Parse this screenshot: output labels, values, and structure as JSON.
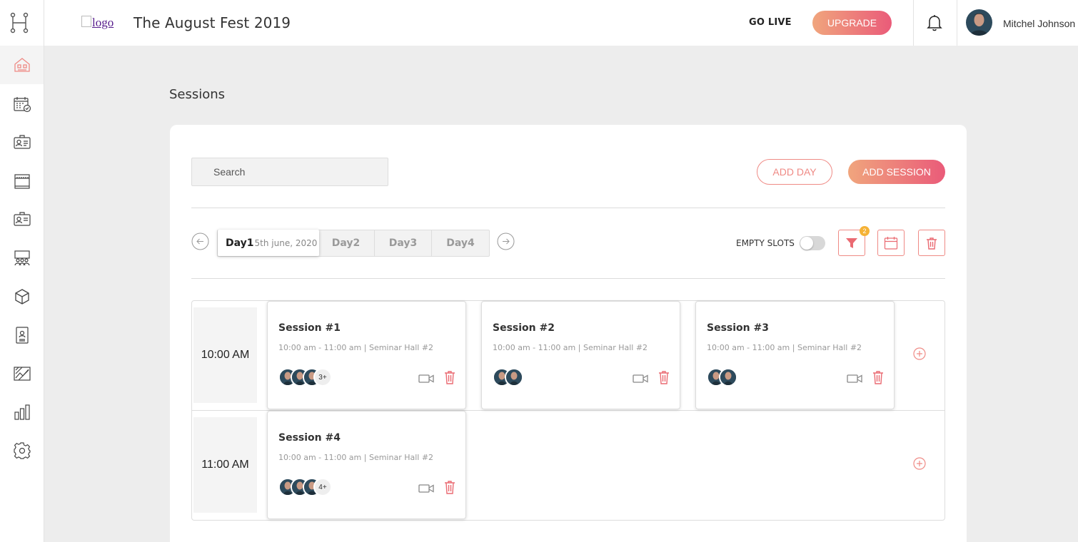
{
  "header": {
    "logo_alt": "logo",
    "title": "The August Fest 2019",
    "go_live": "GO LIVE",
    "upgrade": "UPGRADE",
    "user_name": "Mitchel Johnson"
  },
  "sidebar": {
    "items": [
      {
        "icon": "home-icon",
        "active": true
      },
      {
        "icon": "calendar-check-icon"
      },
      {
        "icon": "id-card-icon"
      },
      {
        "icon": "storefront-icon"
      },
      {
        "icon": "badge-icon"
      },
      {
        "icon": "meeting-icon"
      },
      {
        "icon": "cube-icon"
      },
      {
        "icon": "contact-book-icon"
      },
      {
        "icon": "chart-line-icon"
      },
      {
        "icon": "bar-chart-icon"
      },
      {
        "icon": "settings-icon"
      }
    ]
  },
  "page": {
    "title": "Sessions"
  },
  "toolbar": {
    "search_placeholder": "Search",
    "add_day": "ADD DAY",
    "add_session": "ADD SESSION",
    "empty_slots": "EMPTY SLOTS",
    "filter_badge": "2"
  },
  "days": [
    {
      "label": "Day1",
      "date": "5th june, 2020",
      "active": true
    },
    {
      "label": "Day2"
    },
    {
      "label": "Day3"
    },
    {
      "label": "Day4"
    }
  ],
  "schedule": {
    "rows": [
      {
        "time": "10:00 AM",
        "sessions": [
          {
            "title": "Session #1",
            "meta": "10:00 am - 11:00 am | Seminar Hall #2",
            "more": "3+"
          },
          {
            "title": "Session #2",
            "meta": "10:00 am - 11:00 am | Seminar Hall #2",
            "more": ""
          },
          {
            "title": "Session #3",
            "meta": "10:00 am - 11:00 am | Seminar Hall #2",
            "more": ""
          }
        ]
      },
      {
        "time": "11:00 AM",
        "sessions": [
          {
            "title": "Session #4",
            "meta": "10:00 am - 11:00 am | Seminar Hall #2",
            "more": "4+"
          }
        ]
      }
    ]
  },
  "colors": {
    "accent": "#ef8a85",
    "gradient_start": "#f0a57d",
    "gradient_end": "#ea5b79",
    "badge": "#f5b236"
  }
}
